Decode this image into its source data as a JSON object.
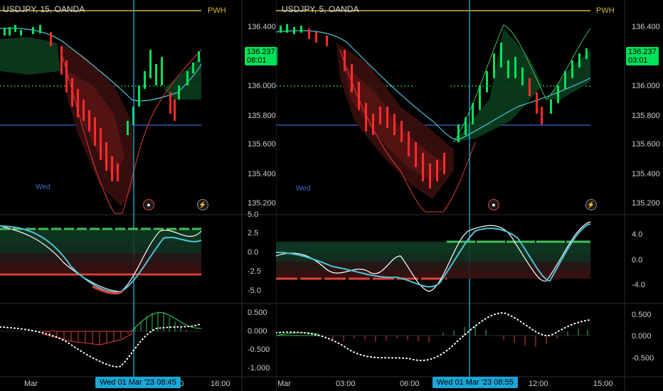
{
  "left_chart": {
    "symbol": "USDJPY, 15, OANDA",
    "pwh_label": "PWH",
    "price_ticks": [
      "136.400",
      "136.000",
      "135.800",
      "135.600",
      "135.400",
      "135.200"
    ],
    "current_price": "136.237",
    "countdown": "08:01",
    "osc_ticks": [
      "5.0",
      "2.5",
      "0.0",
      "-2.5",
      "-5.0"
    ],
    "hist_ticks": [
      "0.500",
      "0.000",
      "-0.500",
      "-1.000"
    ],
    "time_labels": [
      "Mar",
      "00",
      "16:00"
    ],
    "crosshair_time": "Wed 01 Mar '23   08:45",
    "session_label": "Wed"
  },
  "right_chart": {
    "symbol": "USDJPY, 5, OANDA",
    "pwh_label": "PWH",
    "price_ticks": [
      "136.400",
      "136.000",
      "135.800",
      "135.600",
      "135.400",
      "135.200"
    ],
    "current_price": "136.237",
    "countdown": "03:01",
    "osc_ticks": [
      "4.0",
      "0.0",
      "-4.0"
    ],
    "hist_ticks": [
      "0.500",
      "0.000",
      "-0.500"
    ],
    "time_labels": [
      "Mar",
      "03:00",
      "06:00",
      "12:00",
      "15:00"
    ],
    "crosshair_time": "Wed 01 Mar '23   08:55",
    "session_label": "Wed"
  },
  "colors": {
    "bull": "#00e25a",
    "bear": "#ff2b2b",
    "crosshair": "#1fc1e6",
    "pwh": "#d4b83a",
    "level_blue": "#2f6bd9",
    "level_green": "#3fcf3f"
  }
}
